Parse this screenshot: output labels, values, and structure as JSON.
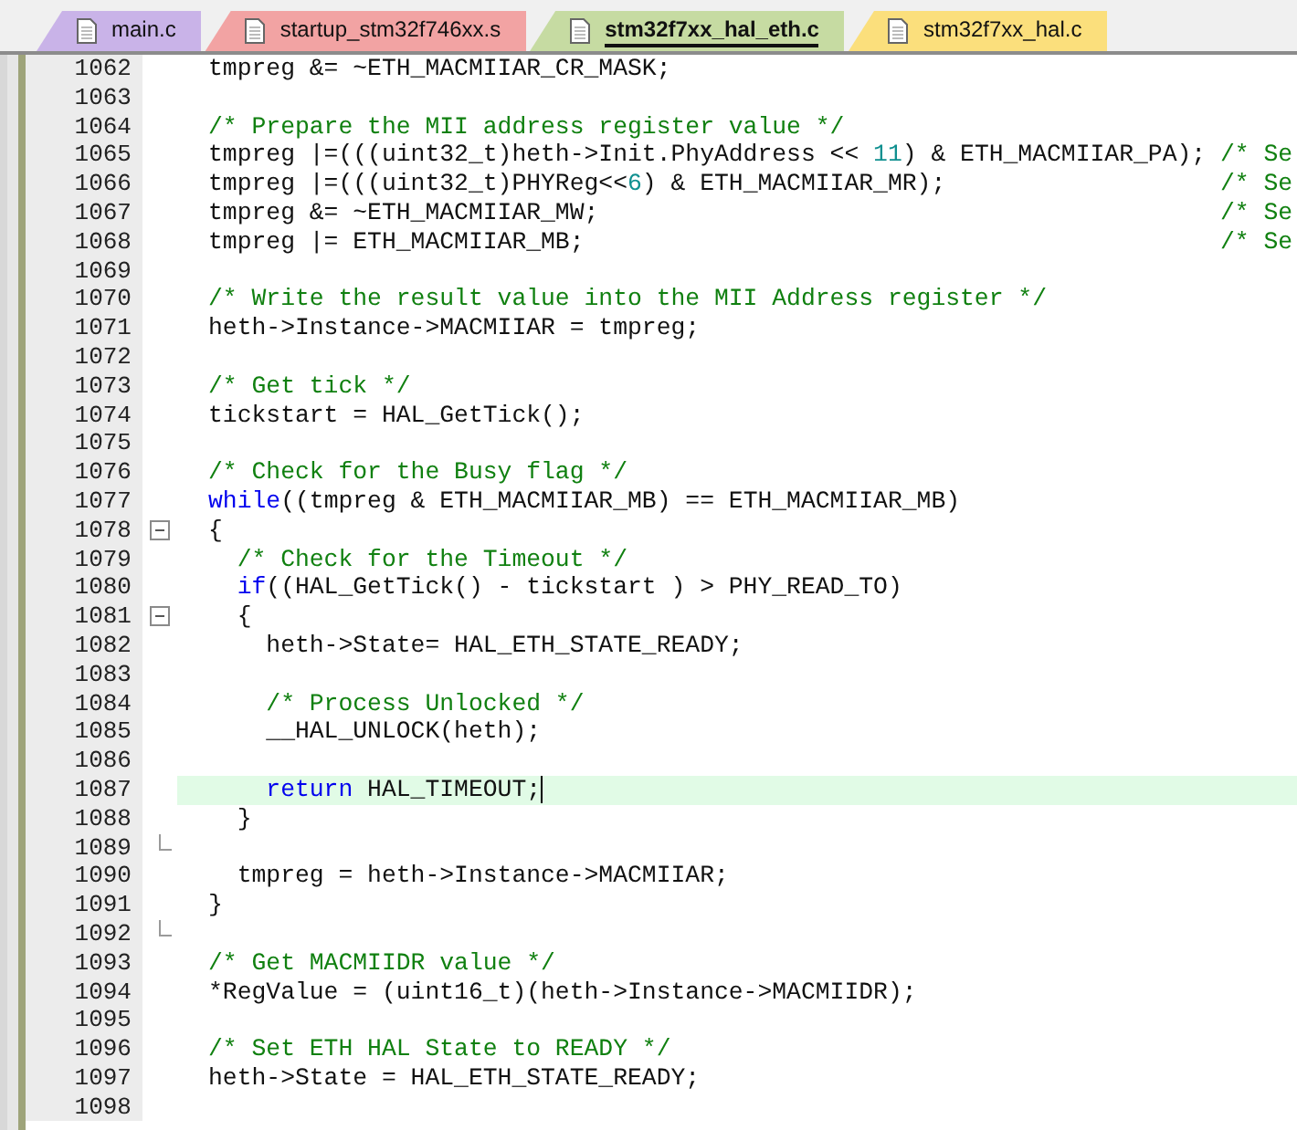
{
  "tabs": [
    {
      "label": "main.c",
      "color": "#c9b3e8",
      "selected": false
    },
    {
      "label": "startup_stm32f746xx.s",
      "color": "#f2a3a3",
      "selected": false
    },
    {
      "label": "stm32f7xx_hal_eth.c",
      "color": "#c6dba2",
      "selected": true
    },
    {
      "label": "stm32f7xx_hal.c",
      "color": "#fbdf7c",
      "selected": false
    }
  ],
  "editor": {
    "lines": [
      {
        "number": "1062",
        "kind": "code",
        "segments": [
          {
            "kind": "plain",
            "text": "tmpreg &= ~ETH_MACMIIAR_CR_MASK;"
          }
        ]
      },
      {
        "number": "1063",
        "kind": "code"
      },
      {
        "number": "1064",
        "kind": "code",
        "segments": [
          {
            "kind": "comment",
            "text": "/* Prepare the MII address register value */"
          }
        ]
      },
      {
        "number": "1065",
        "kind": "code",
        "segments": [
          {
            "kind": "plain",
            "text": "tmpreg |=(((uint32_t)heth->Init.PhyAddress << "
          },
          {
            "kind": "number",
            "text": "11"
          },
          {
            "kind": "plain",
            "text": ") & ETH_MACMIIAR_PA); "
          },
          {
            "kind": "comment",
            "text": "/* Se"
          }
        ]
      },
      {
        "number": "1066",
        "kind": "code",
        "segments": [
          {
            "kind": "plain",
            "text": "tmpreg |=(((uint32_t)PHYReg<<"
          },
          {
            "kind": "number",
            "text": "6"
          },
          {
            "kind": "plain",
            "text": ") & ETH_MACMIIAR_MR);                   "
          },
          {
            "kind": "comment",
            "text": "/* Se"
          }
        ]
      },
      {
        "number": "1067",
        "kind": "code",
        "segments": [
          {
            "kind": "plain",
            "text": "tmpreg &= ~ETH_MACMIIAR_MW;                                           "
          },
          {
            "kind": "comment",
            "text": "/* Se"
          }
        ]
      },
      {
        "number": "1068",
        "kind": "code",
        "segments": [
          {
            "kind": "plain",
            "text": "tmpreg |= ETH_MACMIIAR_MB;                                            "
          },
          {
            "kind": "comment",
            "text": "/* Se"
          }
        ]
      },
      {
        "number": "1069",
        "kind": "code"
      },
      {
        "number": "1070",
        "kind": "code",
        "segments": [
          {
            "kind": "comment",
            "text": "/* Write the result value into the MII Address register */"
          }
        ]
      },
      {
        "number": "1071",
        "kind": "code",
        "segments": [
          {
            "kind": "plain",
            "text": "heth->Instance->MACMIIAR = tmpreg;"
          }
        ]
      },
      {
        "number": "1072",
        "kind": "code"
      },
      {
        "number": "1073",
        "kind": "code",
        "segments": [
          {
            "kind": "comment",
            "text": "/* Get tick */"
          }
        ]
      },
      {
        "number": "1074",
        "kind": "code",
        "segments": [
          {
            "kind": "plain",
            "text": "tickstart = HAL_GetTick();"
          }
        ]
      },
      {
        "number": "1075",
        "kind": "code"
      },
      {
        "number": "1076",
        "kind": "code",
        "segments": [
          {
            "kind": "comment",
            "text": "/* Check for the Busy flag */"
          }
        ]
      },
      {
        "number": "1077",
        "kind": "code",
        "segments": [
          {
            "kind": "keyword",
            "text": "while"
          },
          {
            "kind": "plain",
            "text": "((tmpreg & ETH_MACMIIAR_MB) == ETH_MACMIIAR_MB)"
          }
        ]
      },
      {
        "number": "1078",
        "kind": "fold_start",
        "segments": [
          {
            "kind": "plain",
            "text": "{"
          }
        ]
      },
      {
        "number": "1079",
        "kind": "code",
        "segments": [
          {
            "kind": "comment",
            "text": "  /* Check for the Timeout */"
          }
        ]
      },
      {
        "number": "1080",
        "kind": "code",
        "segments": [
          {
            "kind": "keyword",
            "text": "  if"
          },
          {
            "kind": "plain",
            "text": "((HAL_GetTick() - tickstart ) > PHY_READ_TO)"
          }
        ]
      },
      {
        "number": "1081",
        "kind": "fold_start",
        "segments": [
          {
            "kind": "plain",
            "text": "  {"
          }
        ]
      },
      {
        "number": "1082",
        "kind": "code",
        "segments": [
          {
            "kind": "plain",
            "text": "    heth->State= HAL_ETH_STATE_READY;"
          }
        ]
      },
      {
        "number": "1083",
        "kind": "code"
      },
      {
        "number": "1084",
        "kind": "code",
        "segments": [
          {
            "kind": "comment",
            "text": "    /* Process Unlocked */"
          }
        ]
      },
      {
        "number": "1085",
        "kind": "code",
        "segments": [
          {
            "kind": "plain",
            "text": "    __HAL_UNLOCK(heth);"
          }
        ]
      },
      {
        "number": "1086",
        "kind": "code"
      },
      {
        "number": "1087",
        "kind": "code",
        "current": true,
        "segments": [
          {
            "kind": "keyword",
            "text": "    return"
          },
          {
            "kind": "plain",
            "text": " HAL_TIMEOUT;"
          }
        ]
      },
      {
        "number": "1088",
        "kind": "code",
        "segments": [
          {
            "kind": "plain",
            "text": "  }"
          }
        ]
      },
      {
        "number": "1089",
        "kind": "fold_end"
      },
      {
        "number": "1090",
        "kind": "code",
        "segments": [
          {
            "kind": "plain",
            "text": "  tmpreg = heth->Instance->MACMIIAR;"
          }
        ]
      },
      {
        "number": "1091",
        "kind": "code",
        "segments": [
          {
            "kind": "plain",
            "text": "}"
          }
        ]
      },
      {
        "number": "1092",
        "kind": "fold_end"
      },
      {
        "number": "1093",
        "kind": "code",
        "segments": [
          {
            "kind": "comment",
            "text": "/* Get MACMIIDR value */"
          }
        ]
      },
      {
        "number": "1094",
        "kind": "code",
        "segments": [
          {
            "kind": "plain",
            "text": "*RegValue = (uint16_t)(heth->Instance->MACMIIDR);"
          }
        ]
      },
      {
        "number": "1095",
        "kind": "code"
      },
      {
        "number": "1096",
        "kind": "code",
        "segments": [
          {
            "kind": "comment",
            "text": "/* Set ETH HAL State to READY */"
          }
        ]
      },
      {
        "number": "1097",
        "kind": "code",
        "segments": [
          {
            "kind": "plain",
            "text": "heth->State = HAL_ETH_STATE_READY;"
          }
        ]
      },
      {
        "number": "1098",
        "kind": "code"
      }
    ]
  }
}
